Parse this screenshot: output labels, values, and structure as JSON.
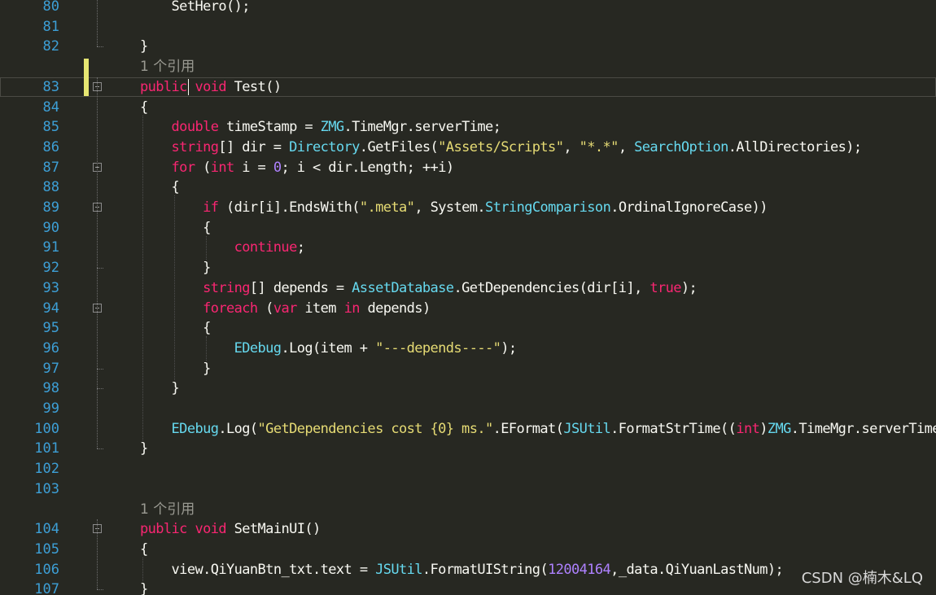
{
  "editor": {
    "lines": [
      {
        "ln": "80",
        "code": "        SetHero();"
      },
      {
        "ln": "81",
        "code": ""
      },
      {
        "ln": "82",
        "code": "    }"
      },
      {
        "ln": "",
        "codelens": "1 个引用"
      },
      {
        "ln": "83",
        "code": "    public void Test()"
      },
      {
        "ln": "84",
        "code": "    {"
      },
      {
        "ln": "85",
        "code": "        double timeStamp = ZMG.TimeMgr.serverTime;"
      },
      {
        "ln": "86",
        "code": "        string[] dir = Directory.GetFiles(\"Assets/Scripts\", \"*.*\", SearchOption.AllDirectories);"
      },
      {
        "ln": "87",
        "code": "        for (int i = 0; i < dir.Length; ++i)"
      },
      {
        "ln": "88",
        "code": "        {"
      },
      {
        "ln": "89",
        "code": "            if (dir[i].EndsWith(\".meta\", System.StringComparison.OrdinalIgnoreCase))"
      },
      {
        "ln": "90",
        "code": "            {"
      },
      {
        "ln": "91",
        "code": "                continue;"
      },
      {
        "ln": "92",
        "code": "            }"
      },
      {
        "ln": "93",
        "code": "            string[] depends = AssetDatabase.GetDependencies(dir[i], true);"
      },
      {
        "ln": "94",
        "code": "            foreach (var item in depends)"
      },
      {
        "ln": "95",
        "code": "            {"
      },
      {
        "ln": "96",
        "code": "                EDebug.Log(item + \"---depends----\");"
      },
      {
        "ln": "97",
        "code": "            }"
      },
      {
        "ln": "98",
        "code": "        }"
      },
      {
        "ln": "99",
        "code": ""
      },
      {
        "ln": "100",
        "code": "        EDebug.Log(\"GetDependencies cost {0} ms.\".EFormat(JSUtil.FormatStrTime((int)ZMG.TimeMgr.serverTime"
      },
      {
        "ln": "101",
        "code": "    }"
      },
      {
        "ln": "102",
        "code": ""
      },
      {
        "ln": "103",
        "code": ""
      },
      {
        "ln": "",
        "codelens": "1 个引用"
      },
      {
        "ln": "104",
        "code": "    public void SetMainUI()"
      },
      {
        "ln": "105",
        "code": "    {"
      },
      {
        "ln": "106",
        "code": "        view.QiYuanBtn_txt.text = JSUtil.FormatUIString(12004164,_data.QiYuanLastNum);"
      },
      {
        "ln": "107",
        "code": "    }"
      }
    ]
  },
  "watermark": "CSDN @楠木&LQ",
  "colors": {
    "background": "#272822",
    "line_number": "#3d9fd6",
    "keyword": "#f92672",
    "type": "#66d9ef",
    "string": "#e6db74",
    "number": "#ae81ff",
    "text": "#f8f8f2",
    "change_marker": "#e6e672"
  },
  "icons": [
    "collapse-icon"
  ]
}
